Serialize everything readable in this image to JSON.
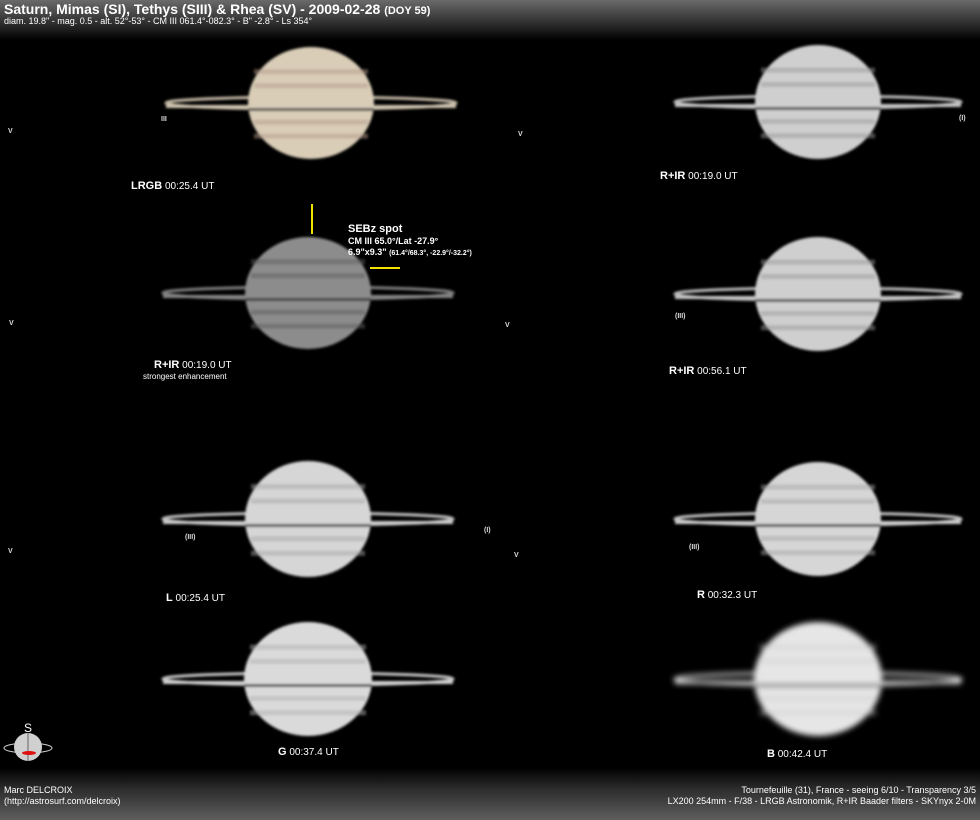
{
  "header": {
    "title": "Saturn, Mimas (SI), Tethys (SIII) & Rhea (SV) - 2009-02-28",
    "doy": "(DOY 59)",
    "subtitle": "diam. 19.8\" - mag. 0.5 - alt. 52°-53° - CM III 061.4°-082.3° - B\" -2.8° - Ls 354°"
  },
  "images": [
    {
      "filter": "LRGB",
      "time": "00:25.4 UT",
      "color": "#d9cdb8",
      "belt": "#b69a8a"
    },
    {
      "filter": "R+IR",
      "time": "00:19.0 UT",
      "color": "#cfcfcf",
      "belt": "#9a9a9a"
    },
    {
      "filter": "R+IR",
      "time": "00:19.0 UT",
      "note": "strongest enhancement",
      "color": "#8c8c8c",
      "belt": "#5c5c5c"
    },
    {
      "filter": "R+IR",
      "time": "00:56.1 UT",
      "color": "#cfcfcf",
      "belt": "#9a9a9a"
    },
    {
      "filter": "L",
      "time": "00:25.4 UT",
      "color": "#d6d6d6",
      "belt": "#a6a6a6"
    },
    {
      "filter": "R",
      "time": "00:32.3 UT",
      "color": "#d6d6d6",
      "belt": "#a6a6a6"
    },
    {
      "filter": "G",
      "time": "00:37.4 UT",
      "color": "#dadada",
      "belt": "#b0b0b0"
    },
    {
      "filter": "B",
      "time": "00:42.4 UT",
      "color": "#e6e6e6",
      "belt": "#cdcdcd"
    }
  ],
  "moons": {
    "v": "V",
    "iii": "III",
    "iii_paren": "(III)",
    "i_paren": "(I)"
  },
  "spot": {
    "title": "SEBz spot",
    "line1": "CM III 65.0°/Lat -27.9°",
    "line2_main": "6.9\"x9.3\"",
    "line2_detail": "(61.4°/68.3°, -22.9°/-32.2°)",
    "marker_color": "#f2e200"
  },
  "compass": {
    "south": "S"
  },
  "footer": {
    "author": "Marc DELCROIX",
    "site": "(http://astrosurf.com/delcroix)",
    "location": "Tournefeuille (31), France - seeing 6/10 - Transparency 3/5",
    "equipment": "LX200 254mm - F/38 - LRGB Astronomik, R+IR Baader filters - SKYnyx 2-0M"
  }
}
